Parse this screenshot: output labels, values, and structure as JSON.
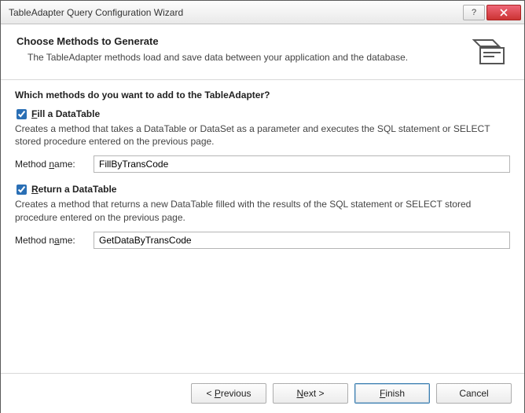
{
  "window": {
    "title": "TableAdapter Query Configuration Wizard"
  },
  "header": {
    "heading": "Choose Methods to Generate",
    "description": "The TableAdapter methods load and save data between your application and the database."
  },
  "question": "Which methods do you want to add to the TableAdapter?",
  "options": {
    "fill": {
      "checked": true,
      "label_prefix": "F",
      "label_rest": "ill a DataTable",
      "explain": "Creates a method that takes a DataTable or DataSet as a parameter and executes the SQL statement or SELECT stored procedure entered on the previous page.",
      "method_label_prefix": "Method ",
      "method_label_u": "n",
      "method_label_suffix": "ame:",
      "method_value": "FillByTransCode"
    },
    "return": {
      "checked": true,
      "label_prefix": "R",
      "label_rest": "eturn a DataTable",
      "explain": "Creates a method that returns a new DataTable filled with the results of the SQL statement or SELECT stored procedure entered on the previous page.",
      "method_label_prefix": "Method n",
      "method_label_u": "a",
      "method_label_suffix": "me:",
      "method_value": "GetDataByTransCode"
    }
  },
  "buttons": {
    "previous_u": "P",
    "previous_rest": "revious",
    "previous_prefix": "< ",
    "next_u": "N",
    "next_rest": "ext >",
    "finish_u": "F",
    "finish_rest": "inish",
    "cancel": "Cancel"
  }
}
